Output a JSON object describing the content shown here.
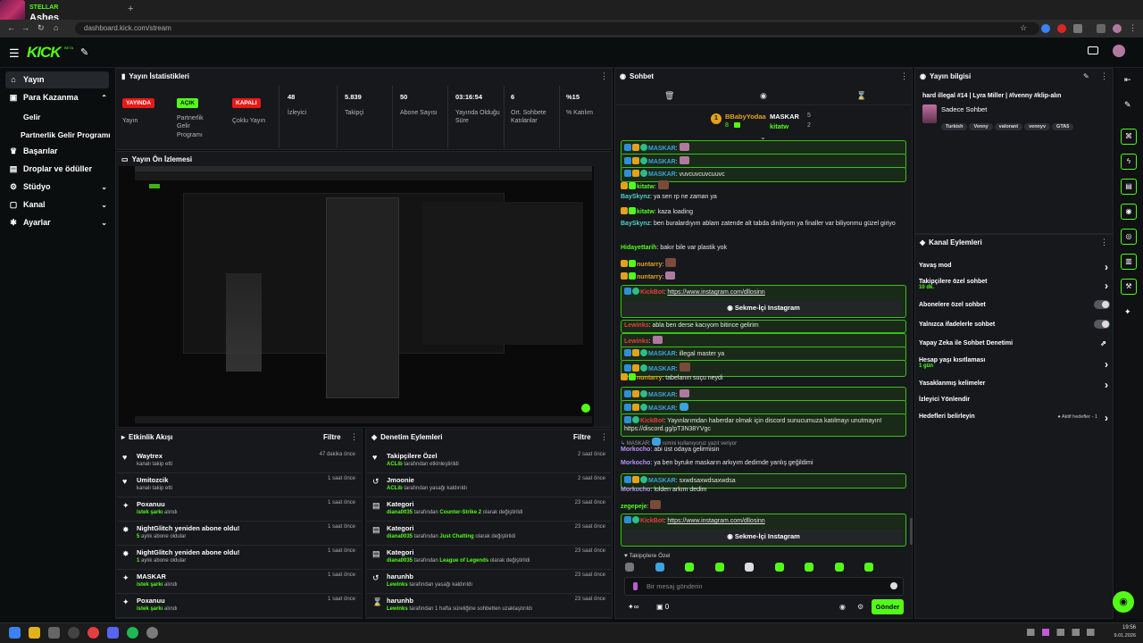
{
  "browser": {
    "tab_channel": "STELLAR",
    "tab_title": "Ashes",
    "url": "dashboard.kick.com/stream",
    "new_tab": "+"
  },
  "header": {
    "logo": "KICK",
    "beta": "BETA"
  },
  "sidebar": {
    "items": [
      {
        "label": "Yayın",
        "icon": "home-icon"
      },
      {
        "label": "Para Kazanma",
        "icon": "money-icon"
      },
      {
        "label": "Gelir"
      },
      {
        "label": "Partnerlik Gelir Programı"
      },
      {
        "label": "Başarılar",
        "icon": "trophy-icon"
      },
      {
        "label": "Droplar ve ödüller",
        "icon": "gift-icon"
      },
      {
        "label": "Stüdyo",
        "icon": "studio-icon"
      },
      {
        "label": "Kanal",
        "icon": "channel-icon"
      },
      {
        "label": "Ayarlar",
        "icon": "settings-icon"
      }
    ]
  },
  "stats": {
    "title": "Yayın İstatistikleri",
    "cells": [
      {
        "badge": "YAYINDA",
        "label": "Yayın",
        "badge_color": "#e91916"
      },
      {
        "badge": "AÇIK",
        "label": "Partnerlik Gelir Programı",
        "badge_color": "#53fc18"
      },
      {
        "badge": "KAPALI",
        "label": "Çoklu Yayın",
        "badge_color": "#e91916"
      },
      {
        "value": "48",
        "label": "İzleyici"
      },
      {
        "value": "5.839",
        "label": "Takipçi"
      },
      {
        "value": "50",
        "label": "Abone Sayısı"
      },
      {
        "value": "03:16:54",
        "label": "Yayında Olduğu Süre"
      },
      {
        "value": "6",
        "label": "Ort. Sohbete Katılanlar"
      },
      {
        "value": "%15",
        "label": "% Katılım"
      }
    ]
  },
  "preview": {
    "title": "Yayın Ön İzlemesi"
  },
  "activity": {
    "title": "Etkinlik Akışı",
    "filter": "Filtre",
    "rows": [
      {
        "icon": "heart-icon",
        "name": "Waytrex",
        "sub": "kanalı takip etti",
        "hl": "",
        "time": "47 dakika önce"
      },
      {
        "icon": "heart-icon",
        "name": "Umitozcik",
        "sub": "kanalı takip etti",
        "hl": "",
        "time": "1 saat önce"
      },
      {
        "icon": "gift-icon",
        "name": "Poxanuu",
        "sub": "alındı",
        "hl": "istek şarkı",
        "time": "1 saat önce"
      },
      {
        "icon": "star-icon",
        "name": "NightGlitch yeniden abone oldu!",
        "sub": "aylık abone oldular",
        "hl": "5",
        "time": "1 saat önce"
      },
      {
        "icon": "star-icon",
        "name": "NightGlitch yeniden abone oldu!",
        "sub": "aylık abone oldular",
        "hl": "1",
        "time": "1 saat önce"
      },
      {
        "icon": "gift-icon",
        "name": "MASKAR",
        "sub": "alındı",
        "hl": "istek şarkı",
        "time": "1 saat önce"
      },
      {
        "icon": "gift-icon",
        "name": "Poxanuu",
        "sub": "alındı",
        "hl": "istek şarkı",
        "time": "1 saat önce"
      }
    ]
  },
  "moderation": {
    "title": "Denetim Eylemleri",
    "filter": "Filtre",
    "rows": [
      {
        "icon": "heart-icon",
        "name": "Takipçilere Özel",
        "who": "ACLib",
        "sub": "tarafından etkinleştirildi",
        "hl2": "",
        "tail": "",
        "time": "2 saat önce"
      },
      {
        "icon": "undo-icon",
        "name": "Jmoonie",
        "who": "ACLib",
        "sub": "tarafından yasağı kaldırıldı",
        "hl2": "",
        "tail": "",
        "time": "2 saat önce"
      },
      {
        "icon": "category-icon",
        "name": "Kategori",
        "who": "diana0035",
        "sub": "tarafından",
        "hl2": "Counter-Strike 2",
        "tail": "olarak değiştirildi",
        "time": "23 saat önce"
      },
      {
        "icon": "category-icon",
        "name": "Kategori",
        "who": "diana0035",
        "sub": "tarafından",
        "hl2": "Just Chatting",
        "tail": "olarak değiştirildi",
        "time": "23 saat önce"
      },
      {
        "icon": "category-icon",
        "name": "Kategori",
        "who": "diana0035",
        "sub": "tarafından",
        "hl2": "League of Legends",
        "tail": "olarak değiştirildi",
        "time": "23 saat önce"
      },
      {
        "icon": "undo-icon",
        "name": "harunhb",
        "who": "Lewinks",
        "sub": "tarafından yasağı kaldırıldı",
        "hl2": "",
        "tail": "",
        "time": "23 saat önce"
      },
      {
        "icon": "hourglass-icon",
        "name": "harunhb",
        "who": "Lewinks",
        "sub": "tarafından 1 hafta süreliğine sohbetten uzaklaştırıldı",
        "hl2": "",
        "tail": "",
        "time": "23 saat önce"
      }
    ]
  },
  "chat": {
    "title": "Sohbet",
    "top_gifters": [
      {
        "rank": "1",
        "name": "BBabyYodaa",
        "count": "8"
      },
      {
        "name": "MASKAR",
        "count": "5"
      },
      {
        "name": "kitatw",
        "count": "2"
      }
    ],
    "messages": [
      {
        "nick": "MASKAR",
        "color": "#3ca3e0",
        "text": "",
        "emote": true,
        "hl": true
      },
      {
        "nick": "MASKAR",
        "color": "#3ca3e0",
        "text": "",
        "emote": true,
        "hl": true
      },
      {
        "nick": "MASKAR",
        "color": "#3ca3e0",
        "text": "vuvcuvcuvcuuvc",
        "hl": true
      },
      {
        "nick": "kitatw",
        "color": "#53fc18",
        "text": "",
        "emote2": true
      },
      {
        "nick": "BaySkynz",
        "color": "#4fd1c5",
        "text": "ya sen rp ne zaman ya"
      },
      {
        "nick": "kitatw",
        "color": "#53fc18",
        "text": "kaza loading"
      },
      {
        "nick": "BaySkynz",
        "color": "#4fd1c5",
        "text": "ben buralardıyım ablam zatende alt tabda diniliyom ya finaller var biliyonmu güzel giriyo"
      },
      {
        "nick": "Hidayettarih",
        "color": "#53fc18",
        "text": "bakır bile var plastik yok"
      },
      {
        "nick": "nuntarry",
        "color": "#e2a21b",
        "text": "",
        "emote2": true
      },
      {
        "nick": "nuntarry",
        "color": "#e2a21b",
        "text": "",
        "emote": true
      },
      {
        "nick": "KickBot",
        "color": "#e53e3e",
        "text": "https://www.instagram.com/dllosinn",
        "hl": true,
        "link": true,
        "button": "Sekme-İçi Instagram"
      },
      {
        "nick": "Lewinks",
        "color": "#e53e3e",
        "text": "abla ben derse kacıyom bitince gelirim",
        "hl": true
      },
      {
        "nick": "Lewinks",
        "color": "#e53e3e",
        "text": "",
        "emote": true,
        "hl": true
      },
      {
        "nick": "MASKAR",
        "color": "#3ca3e0",
        "text": "illegal master ya",
        "hl": true
      },
      {
        "nick": "MASKAR",
        "color": "#3ca3e0",
        "text": "",
        "emote2": true,
        "hl": true
      },
      {
        "nick": "nuntarry",
        "color": "#e2a21b",
        "text": "tabelanın suçu neydi"
      },
      {
        "nick": "MASKAR",
        "color": "#3ca3e0",
        "text": "",
        "emote": true,
        "hl": true
      },
      {
        "nick": "MASKAR",
        "color": "#3ca3e0",
        "text": "",
        "heart": true,
        "hl": true
      },
      {
        "nick": "KickBot",
        "color": "#e53e3e",
        "text": "Yayınlarımdan haberdar olmak için discord sunucumuza katılmayı unutmayın! https://discord.gg/pT3N38YVgc",
        "hl": true
      },
      {
        "reply": "↳ MASKAR:",
        "reply_text": "ismini kullanıyoruz yazıt veriyor"
      },
      {
        "nick": "Morkocho",
        "color": "#b794f4",
        "text": "abi üst odaya gelirmisin"
      },
      {
        "nick": "Morkocho",
        "color": "#b794f4",
        "text": "ya ben byruke maskarın arkıyım dedimde yanlış geğildimi"
      },
      {
        "nick": "MASKAR",
        "color": "#3ca3e0",
        "text": "sxwdsaxwdsaxwdsa",
        "hl": true
      },
      {
        "nick": "Morkocho",
        "color": "#b794f4",
        "text": "lolden arkım dedim"
      },
      {
        "nick": "zegepeje",
        "color": "#53fc18",
        "text": "",
        "emote2": true
      },
      {
        "nick": "KickBot",
        "color": "#e53e3e",
        "text": "https://www.instagram.com/dllosinn",
        "hl": true,
        "link": true,
        "button": "Sekme-İçi Instagram"
      }
    ],
    "followers_only": "Takipçilere Özel",
    "input_placeholder": "Bir mesaj gönderin",
    "viewer_count": "0",
    "send": "Gönder"
  },
  "stream_info": {
    "title": "Yayın bilgisi",
    "stream_title": "hard illegal #14 | Lyra Miller | #lvenny #klip-alın",
    "chat_mode": "Sadece Sohbet",
    "tags": [
      "Turkish",
      "Venny",
      "valorant",
      "vennyv",
      "GTA5"
    ]
  },
  "channel_actions": {
    "title": "Kanal Eylemleri",
    "rows": [
      {
        "label": "Yavaş mod",
        "sub": "",
        "control": "chevron"
      },
      {
        "label": "Takipçilere özel sohbet",
        "sub": "10 dk.",
        "control": "chevron"
      },
      {
        "label": "Abonelere özel sohbet",
        "sub": "",
        "control": "toggle"
      },
      {
        "label": "Yalnızca ifadelerle sohbet",
        "sub": "",
        "control": "toggle"
      },
      {
        "label": "Yapay Zeka ile Sohbet Denetimi",
        "sub": "",
        "control": "external"
      },
      {
        "label": "Hesap yaşı kısıtlaması",
        "sub": "1 gün",
        "control": "chevron"
      },
      {
        "label": "Yasaklanmış kelimeler",
        "sub": "",
        "control": "chevron"
      },
      {
        "label": "İzleyici Yönlendir",
        "sub": "",
        "control": "none"
      },
      {
        "label": "Hedefleri belirleyin",
        "sub": "",
        "control": "goal",
        "goal": "Aktif hedefler - 1"
      }
    ]
  },
  "taskbar": {
    "time": "19:56",
    "date": "9.01.2026"
  },
  "colors": {
    "accent": "#53fc18",
    "live": "#e91916",
    "panel": "#16181c",
    "bg": "#0b0e0f"
  }
}
